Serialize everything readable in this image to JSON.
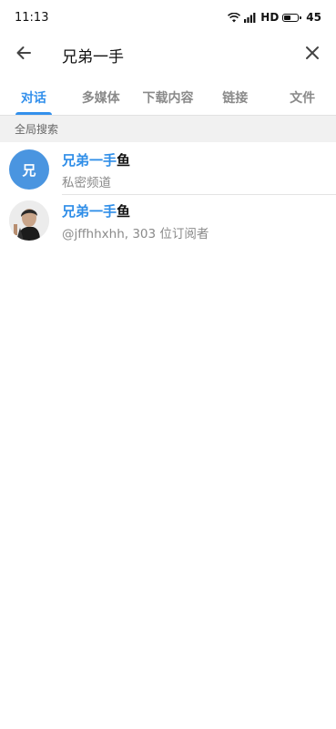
{
  "status_bar": {
    "time": "11:13",
    "network": "HD",
    "battery": "45"
  },
  "search": {
    "query": "兄弟一手"
  },
  "tabs": [
    {
      "label": "对话",
      "active": true
    },
    {
      "label": "多媒体",
      "active": false
    },
    {
      "label": "下载内容",
      "active": false
    },
    {
      "label": "链接",
      "active": false
    },
    {
      "label": "文件",
      "active": false
    }
  ],
  "section": {
    "title": "全局搜索"
  },
  "results": [
    {
      "avatar_text": "兄",
      "title_highlight": "兄弟一手",
      "title_rest": "鱼",
      "subtitle": "私密频道"
    },
    {
      "avatar_text": "",
      "title_highlight": "兄弟一手",
      "title_rest": "鱼",
      "subtitle": "@jffhhxhh, 303 位订阅者"
    }
  ],
  "colors": {
    "accent": "#3390ec",
    "avatar_blue": "#4a95e0"
  }
}
